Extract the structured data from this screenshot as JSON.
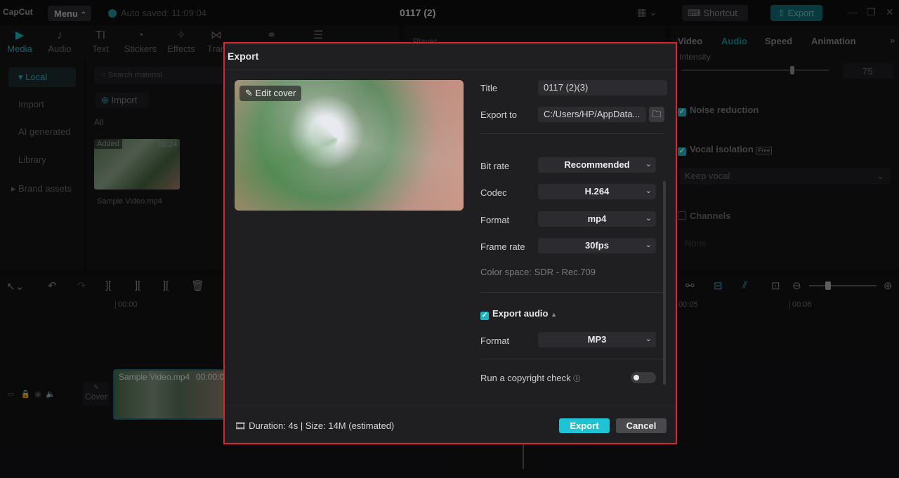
{
  "app": {
    "logo": "CapCut",
    "menu": "Menu",
    "autosave": "Auto saved: 11:09:04",
    "project": "0117 (2)",
    "shortcut": "Shortcut",
    "export": "Export"
  },
  "tools": [
    {
      "label": "Media",
      "icon": "▶"
    },
    {
      "label": "Audio",
      "icon": "♪"
    },
    {
      "label": "Text",
      "icon": "TI"
    },
    {
      "label": "Stickers",
      "icon": "◔"
    },
    {
      "label": "Effects",
      "icon": "✧"
    },
    {
      "label": "Tran",
      "icon": "⋈"
    }
  ],
  "leftnav": [
    "Local",
    "Import",
    "AI generated",
    "Library",
    "Brand assets"
  ],
  "media": {
    "search_placeholder": "Search material",
    "import": "Import",
    "all": "All",
    "clip_badge": "Added",
    "clip_duration": "00:24",
    "clip_name": "Sample Video.mp4"
  },
  "player": "Player",
  "right": {
    "tabs": [
      "Video",
      "Audio",
      "Speed",
      "Animation"
    ],
    "intensity_label": "Intensity",
    "intensity_value": "75",
    "noise": "Noise reduction",
    "vocal": "Vocal isolation",
    "vocal_badge": "Free",
    "keep": "Keep vocal",
    "channels": "Channels",
    "none": "None"
  },
  "timeline": {
    "t0": "00:00",
    "t5": "00:05",
    "t6": "00:06",
    "cover": "Cover",
    "clip": "Sample Video.mp4",
    "clip_time": "00:00:0"
  },
  "dialog": {
    "title": "Export",
    "edit_cover": "Edit cover",
    "title_label": "Title",
    "title_value": "0117 (2)(3)",
    "export_to_label": "Export to",
    "export_to_value": "C:/Users/HP/AppData...",
    "bitrate_label": "Bit rate",
    "bitrate_value": "Recommended",
    "codec_label": "Codec",
    "codec_value": "H.264",
    "format_label": "Format",
    "format_value": "mp4",
    "framerate_label": "Frame rate",
    "framerate_value": "30fps",
    "colorspace": "Color space: SDR - Rec.709",
    "export_audio": "Export audio",
    "audio_format_label": "Format",
    "audio_format_value": "MP3",
    "copyright": "Run a copyright check",
    "footer_info": "Duration: 4s | Size: 14M (estimated)",
    "export_btn": "Export",
    "cancel_btn": "Cancel"
  }
}
